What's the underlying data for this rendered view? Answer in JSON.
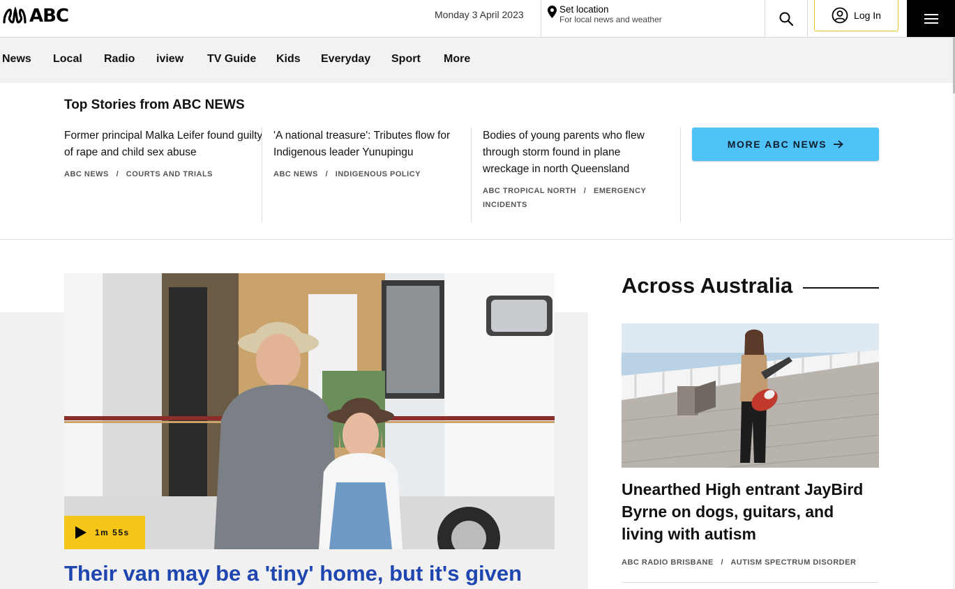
{
  "header": {
    "logo_text": "ABC",
    "date": "Monday 3 April 2023",
    "location_title": "Set location",
    "location_subtitle": "For local news and weather",
    "login_label": "Log In"
  },
  "nav": {
    "items": [
      {
        "label": "News"
      },
      {
        "label": "Local"
      },
      {
        "label": "Radio"
      },
      {
        "label": "iview"
      },
      {
        "label": "TV Guide"
      },
      {
        "label": "Kids"
      },
      {
        "label": "Everyday"
      },
      {
        "label": "Sport"
      },
      {
        "label": "More"
      }
    ]
  },
  "top_stories": {
    "heading": "Top Stories from ABC NEWS",
    "stories": [
      {
        "headline": "Former principal Malka Leifer found guilty of rape and child sex abuse",
        "source": "ABC NEWS",
        "topic": "COURTS AND TRIALS"
      },
      {
        "headline": "'A national treasure': Tributes flow for Indigenous leader Yunupingu",
        "source": "ABC NEWS",
        "topic": "INDIGENOUS POLICY"
      },
      {
        "headline": "Bodies of young parents who flew through storm found in plane wreckage in north Queensland",
        "source": "ABC TROPICAL NORTH",
        "topic": "EMERGENCY INCIDENTS"
      }
    ],
    "more_button": "MORE ABC NEWS"
  },
  "lead_story": {
    "video_duration": "1m 55s",
    "headline": "Their van may be a 'tiny' home, but it's given"
  },
  "across_australia": {
    "heading": "Across Australia",
    "headline": "Unearthed High entrant JayBird Byrne on dogs, guitars, and living with autism",
    "source": "ABC RADIO BRISBANE",
    "topic": "AUTISM SPECTRUM DISORDER"
  },
  "colors": {
    "accent_blue": "#4fc3f7",
    "headline_blue": "#1f46b0",
    "badge_yellow": "#f5c518",
    "login_border": "#e6c020"
  },
  "icons": [
    "abc-logo-icon",
    "location-pin-icon",
    "search-icon",
    "user-account-icon",
    "hamburger-menu-icon",
    "arrow-right-icon",
    "play-icon"
  ]
}
